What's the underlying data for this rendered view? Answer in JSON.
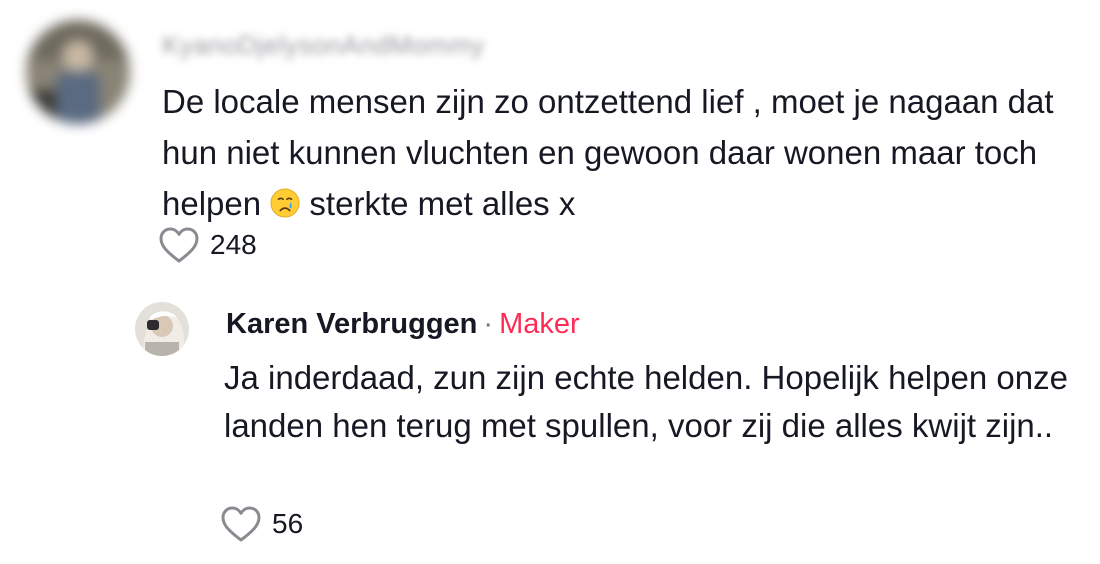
{
  "comment": {
    "username": "KyanoDjelysonAndMommy",
    "text_part1": "De locale mensen zijn zo ontzettend lief , moet je nagaan dat hun niet kunnen vluchten en gewoon daar wonen maar toch helpen ",
    "emoji_icon": "crying-face-emoji",
    "text_part2": " sterkte met alles x",
    "like_count": "248"
  },
  "reply": {
    "author": "Karen Verbruggen",
    "separator": "·",
    "badge": "Maker",
    "badge_color": "#fe2c55",
    "text": "Ja inderdaad, zun zijn echte helden. Hopelijk helpen onze landen hen terug met spullen, voor zij die alles kwijt zijn..",
    "like_count": "56"
  }
}
